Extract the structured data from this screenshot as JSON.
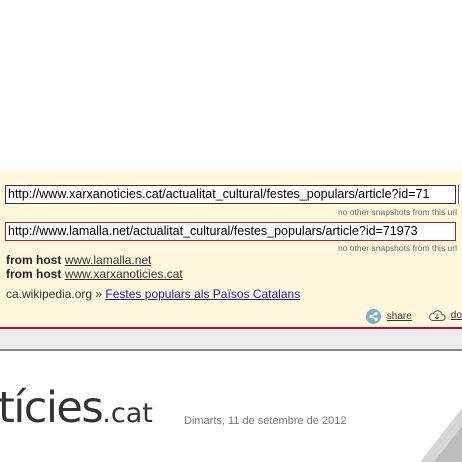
{
  "wayback": {
    "primary_url": "http://www.xarxanoticies.cat/actualitat_cultural/festes_populars/article?id=71",
    "primary_note": "no other snapshots from this url",
    "secondary_url": "http://www.lamalla.net/actualitat_cultural/festes_populars/article?id=71973",
    "secondary_note": "no other snapshots from this url",
    "hosts": [
      {
        "label": "from host",
        "link": "www.lamalla.net"
      },
      {
        "label": "from host",
        "link": "www.xarxanoticies.cat"
      }
    ],
    "wiki_source": "ca.wikipedia.org",
    "wiki_separator": "»",
    "wiki_link": "Festes populars als Països Catalans",
    "share_label": "share",
    "download_label": "do",
    "accent_color": "#b0122a"
  },
  "site": {
    "logo_text": "tícies",
    "logo_tld": ".cat",
    "date": "Dimarts, 11 de setembre de 2012"
  }
}
